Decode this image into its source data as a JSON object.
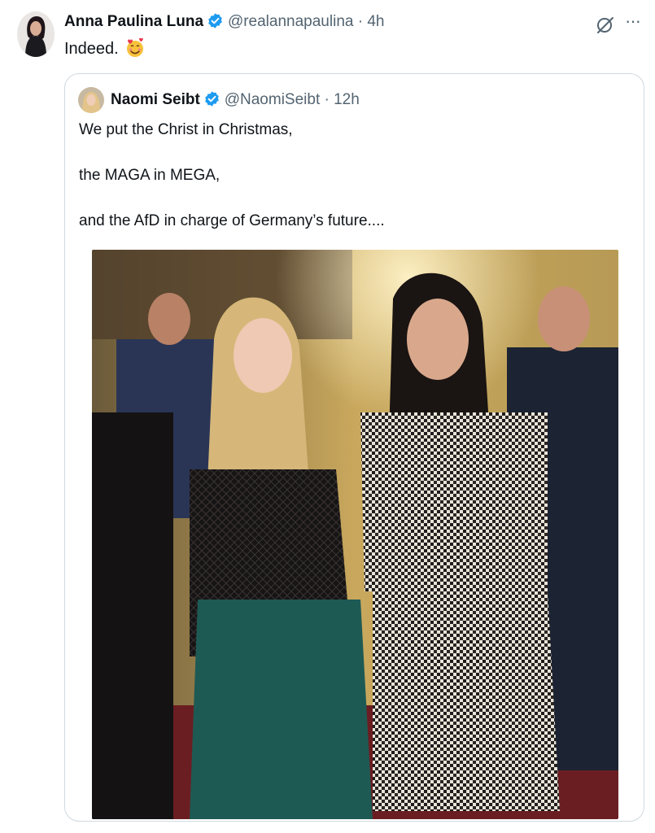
{
  "tweet": {
    "author_name": "Anna Paulina Luna",
    "handle_time": "@realannapaulina · 4h",
    "text": "Indeed.",
    "emoji": "smiling-face-with-hearts-icon",
    "verified": true
  },
  "toolbar": {
    "grok_icon": "grok-icon",
    "more_label": "···"
  },
  "quote": {
    "author_name": "Naomi Seibt",
    "handle_time": "@NaomiSeibt · 12h",
    "verified": true,
    "lines": [
      "We put the Christ in Christmas,",
      "the MAGA in MEGA,",
      "and the AfD in charge of Germany’s future...."
    ]
  },
  "colors": {
    "verified_blue": "#1d9bf0",
    "muted_text": "#536471",
    "border": "#cfd9de"
  }
}
